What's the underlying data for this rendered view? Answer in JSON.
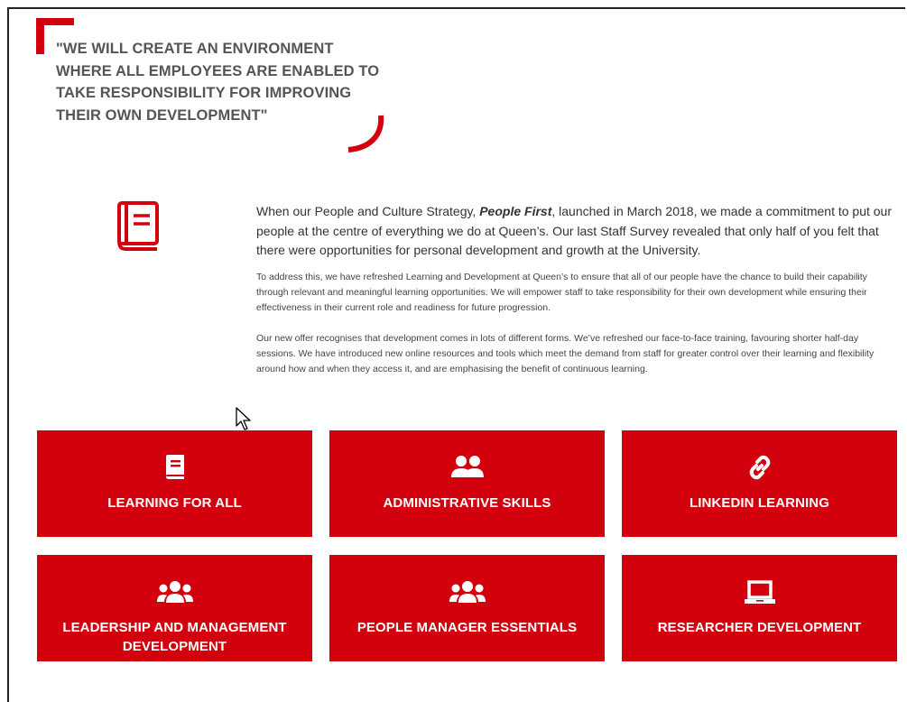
{
  "quote": {
    "text": "\"WE WILL CREATE AN ENVIRONMENT WHERE ALL EMPLOYEES ARE ENABLED TO TAKE RESPONSIBILITY FOR IMPROVING THEIR OWN DEVELOPMENT\""
  },
  "intro": {
    "before": "When our People and Culture Strategy, ",
    "emphasis": "People First",
    "after": ", launched in March 2018, we made a commitment to put our people at the centre of everything we do at Queen’s. Our last Staff Survey revealed that only half of you felt that there were opportunities for personal development and growth at the University."
  },
  "paragraphs": [
    "To address this, we have refreshed Learning and Development at Queen’s to ensure that all of our people have the chance to build their capability through relevant and meaningful learning opportunities. We will empower staff to take responsibility for their own development while ensuring their effectiveness in their current role and readiness for future progression.",
    "Our new offer recognises that development comes in lots of different forms. We’ve refreshed our face-to-face training, favouring shorter half-day sessions. We have introduced new online resources and tools which meet the demand from staff for greater control over their learning and flexibility around how and when they access it, and are emphasising the benefit of continuous learning."
  ],
  "tiles": [
    {
      "label": "LEARNING FOR ALL",
      "icon": "book-icon"
    },
    {
      "label": "ADMINISTRATIVE SKILLS",
      "icon": "users-icon"
    },
    {
      "label": "LINKEDIN LEARNING",
      "icon": "link-icon"
    },
    {
      "label": "LEADERSHIP AND MANAGEMENT DEVELOPMENT",
      "icon": "group-icon"
    },
    {
      "label": "PEOPLE MANAGER ESSENTIALS",
      "icon": "group-icon"
    },
    {
      "label": "RESEARCHER DEVELOPMENT",
      "icon": "laptop-icon"
    }
  ],
  "colors": {
    "brand_red": "#d3000e",
    "quote_text": "#555555",
    "body_text": "#333333"
  }
}
